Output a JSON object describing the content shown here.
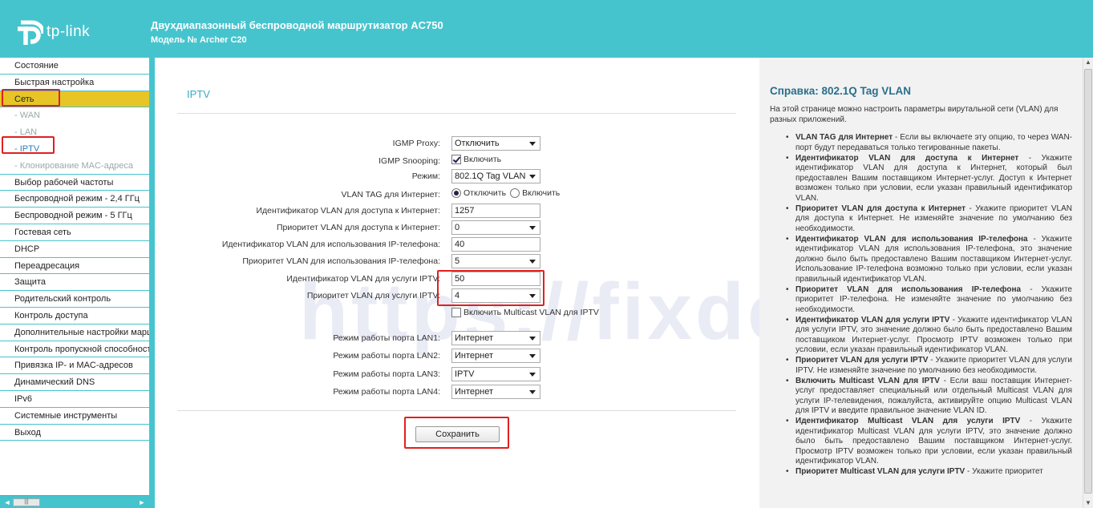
{
  "header": {
    "logo_text": "tp-link",
    "title": "Двухдиапазонный беспроводной маршрутизатор AC750",
    "model": "Модель № Archer C20"
  },
  "colors": {
    "brand": "#46c4ce",
    "active_menu": "#e7c527",
    "highlight": "#e02020",
    "section_title": "#3aa8c9"
  },
  "sidebar": {
    "items": [
      {
        "label": "Состояние",
        "type": "main"
      },
      {
        "label": "Быстрая настройка",
        "type": "main"
      },
      {
        "label": "Сеть",
        "type": "active"
      },
      {
        "label": "- WAN",
        "type": "sub"
      },
      {
        "label": "- LAN",
        "type": "sub"
      },
      {
        "label": "- IPTV",
        "type": "sub-current"
      },
      {
        "label": "- Клонирование MAC-адреса",
        "type": "sub-last"
      },
      {
        "label": "Выбор рабочей частоты",
        "type": "main"
      },
      {
        "label": "Беспроводной режим - 2,4 ГГц",
        "type": "main"
      },
      {
        "label": "Беспроводной режим - 5 ГГц",
        "type": "main"
      },
      {
        "label": "Гостевая сеть",
        "type": "main"
      },
      {
        "label": "DHCP",
        "type": "main"
      },
      {
        "label": "Переадресация",
        "type": "main"
      },
      {
        "label": "Защита",
        "type": "main"
      },
      {
        "label": "Родительский контроль",
        "type": "main"
      },
      {
        "label": "Контроль доступа",
        "type": "main"
      },
      {
        "label": "Дополнительные настройки маршрутизации",
        "type": "main"
      },
      {
        "label": "Контроль пропускной способности",
        "type": "main"
      },
      {
        "label": "Привязка IP- и MAC-адресов",
        "type": "main"
      },
      {
        "label": "Динамический DNS",
        "type": "main"
      },
      {
        "label": "IPv6",
        "type": "main"
      },
      {
        "label": "Системные инструменты",
        "type": "main"
      },
      {
        "label": "Выход",
        "type": "main"
      }
    ]
  },
  "main": {
    "section_title": "IPTV",
    "watermark": "https://fixdev",
    "fields": {
      "igmp_proxy": {
        "label": "IGMP Proxy:",
        "value": "Отключить"
      },
      "igmp_snooping": {
        "label": "IGMP Snooping:",
        "option": "Включить",
        "checked": true
      },
      "mode": {
        "label": "Режим:",
        "value": "802.1Q Tag VLAN"
      },
      "vlan_tag_internet": {
        "label": "VLAN TAG для Интернет:",
        "option_off": "Отключить",
        "option_on": "Включить",
        "selected": "off"
      },
      "internet_vlan_id": {
        "label": "Идентификатор VLAN для доступа к Интернет:",
        "value": "1257"
      },
      "internet_vlan_priority": {
        "label": "Приоритет VLAN для доступа к Интернет:",
        "value": "0"
      },
      "ip_phone_vlan_id": {
        "label": "Идентификатор VLAN для использования IP-телефона:",
        "value": "40"
      },
      "ip_phone_vlan_priority": {
        "label": "Приоритет VLAN для использования IP-телефона:",
        "value": "5"
      },
      "iptv_vlan_id": {
        "label": "Идентификатор VLAN для услуги IPTV:",
        "value": "50"
      },
      "iptv_vlan_priority": {
        "label": "Приоритет VLAN для услуги IPTV:",
        "value": "4"
      },
      "multicast_vlan": {
        "label": "Включить Multicast VLAN для IPTV",
        "checked": false
      },
      "lan1": {
        "label": "Режим работы порта LAN1:",
        "value": "Интернет"
      },
      "lan2": {
        "label": "Режим работы порта LAN2:",
        "value": "Интернет"
      },
      "lan3": {
        "label": "Режим работы порта LAN3:",
        "value": "IPTV"
      },
      "lan4": {
        "label": "Режим работы порта LAN4:",
        "value": "Интернет"
      }
    },
    "save_label": "Сохранить"
  },
  "help": {
    "title": "Справка: 802.1Q Tag VLAN",
    "intro": "На этой странице можно настроить параметры вирутальной сети (VLAN) для разных приложений.",
    "items": [
      {
        "term": "VLAN TAG для Интернет",
        "text": " - Если вы включаете эту опцию, то через WAN-порт будут передаваться только тегированные пакеты."
      },
      {
        "term": "Идентификатор VLAN для доступа к Интернет",
        "text": " - Укажите идентификатор VLAN для доступа к Интернет, который был предоставлен Вашим поставщиком Интернет-услуг. Доступ к Интернет возможен только при условии, если указан правильный идентификатор VLAN."
      },
      {
        "term": "Приоритет VLAN для доступа к Интернет",
        "text": " - Укажите приоритет VLAN для доступа к Интернет. Не изменяйте значение по умолчанию без необходимости."
      },
      {
        "term": "Идентификатор VLAN для использования IP-телефона",
        "text": " - Укажите идентификатор VLAN для использования IP-телефона, это значение должно было быть предоставлено Вашим поставщиком Интернет-услуг. Использование IP-телефона возможно только при условии, если указан правильный идентификатор VLAN."
      },
      {
        "term": "Приоритет VLAN для использования IP-телефона",
        "text": " - Укажите приоритет IP-телефона. Не изменяйте значение по умолчанию без необходимости."
      },
      {
        "term": "Идентификатор VLAN для услуги IPTV",
        "text": " - Укажите идентификатор VLAN для услуги IPTV, это значение должно было быть предоставлено Вашим поставщиком Интернет-услуг. Просмотр IPTV возможен только при условии, если указан правильный идентификатор VLAN."
      },
      {
        "term": "Приоритет VLAN для услуги IPTV",
        "text": " - Укажите приоритет VLAN для услуги IPTV. Не изменяйте значение по умолчанию без необходимости."
      },
      {
        "term": "Включить Multicast VLAN для IPTV",
        "text": " - Если ваш поставщик Интернет-услуг предоставляет специальный или отдельный Multicast VLAN для услуги IP-телевидения, пожалуйста, активируйте опцию Multicast VLAN для IPTV и введите правильное значение VLAN ID."
      },
      {
        "term": "Идентификатор Multicast VLAN для услуги IPTV",
        "text": " - Укажите идентификатор Multicast VLAN для услуги IPTV, это значение должно было быть предоставлено Вашим поставщиком Интернет-услуг. Просмотр IPTV возможен только при условии, если указан правильный идентификатор VLAN."
      },
      {
        "term": "Приоритет Multicast VLAN для услуги IPTV",
        "text": " - Укажите приоритет"
      }
    ]
  }
}
